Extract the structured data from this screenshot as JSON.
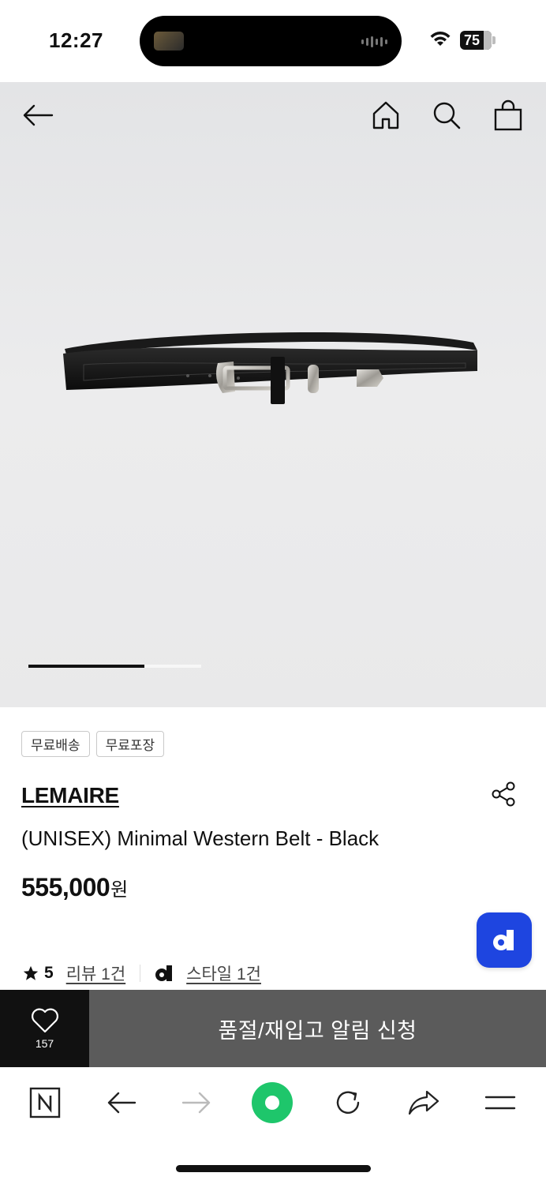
{
  "status_bar": {
    "time": "12:27",
    "battery": "75",
    "icons": {
      "wifi": "wifi-icon",
      "battery": "battery-icon"
    }
  },
  "hero_nav": {
    "icons": [
      "back-arrow-icon",
      "home-icon",
      "search-icon",
      "shopping-bag-icon"
    ]
  },
  "gallery": {
    "current_fraction": 0.67,
    "image_name": "belt-product-image"
  },
  "product": {
    "badges": [
      "무료배송",
      "무료포장"
    ],
    "brand": "LEMAIRE",
    "name": "(UNISEX) Minimal Western Belt - Black",
    "price": "555,000",
    "price_unit": "원",
    "rating": "5",
    "review_link": "리뷰 1건",
    "style_link": "스타일 1건"
  },
  "purchase_bar": {
    "wish_count": "157",
    "notify_label": "품절/재입고 알림 신청"
  },
  "browser_toolbar": {
    "icons": [
      "naver-n-icon",
      "back-icon",
      "forward-icon",
      "green-dot-icon",
      "refresh-icon",
      "share-icon",
      "menu-icon"
    ]
  },
  "colors": {
    "fab": "#1e45e0",
    "notify_bg": "#5b5b5b",
    "wish_bg": "#111111",
    "green": "#1ec66b"
  }
}
